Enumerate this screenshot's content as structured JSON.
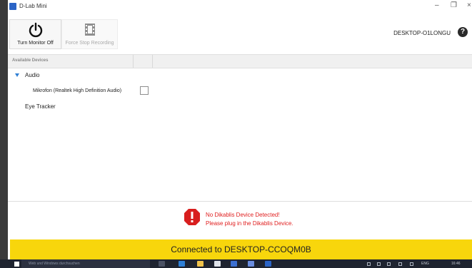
{
  "window": {
    "title": "D-Lab Mini",
    "minimize_glyph": "–",
    "restore_glyph": "❐",
    "close_glyph": "×"
  },
  "toolbar": {
    "monitor_button": {
      "label": "Turn Monitor Off",
      "icon": "power-icon"
    },
    "stop_button": {
      "label": "Force Stop Recording",
      "icon": "film-stop-icon"
    }
  },
  "header_right": {
    "pc_name": "DESKTOP-O1LONGU",
    "help_glyph": "?"
  },
  "devices": {
    "header_label": "Available Devices",
    "audio": {
      "label": "Audio",
      "expanded": true,
      "items": [
        {
          "label": "Mikrofon (Realtek High Definition Audio)",
          "checked": false
        }
      ]
    },
    "eye_tracker": {
      "label": "Eye Tracker"
    }
  },
  "message": {
    "line1": "No Dikablis Device Detected!",
    "line2": "Please plug in the Dikablis Device.",
    "color": "#e02020"
  },
  "status": {
    "text": "Connected to DESKTOP-CCOQM0B",
    "color": "#f8d60c"
  },
  "taskbar": {
    "search_placeholder": "Web und Windows durchsuchen",
    "language": "ENG",
    "time": "16:46"
  }
}
